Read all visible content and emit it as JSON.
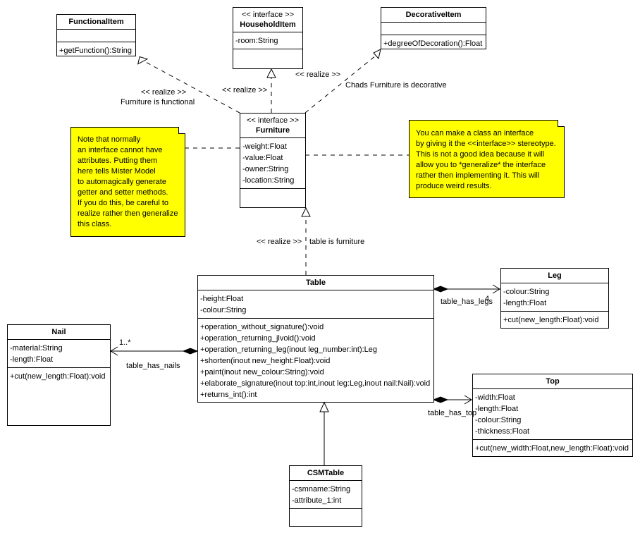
{
  "classes": {
    "functional_item": {
      "name": "FunctionalItem",
      "attributes": [],
      "operations": [
        "+getFunction():String"
      ]
    },
    "household_item": {
      "stereotype": "<< interface >>",
      "name": "HouseholdItem",
      "attributes": [
        "-room:String"
      ],
      "operations": []
    },
    "decorative_item": {
      "name": "DecorativeItem",
      "attributes": [],
      "operations": [
        "+degreeOfDecoration():Float"
      ]
    },
    "furniture": {
      "stereotype": "<< interface >>",
      "name": "Furniture",
      "attributes": [
        "-weight:Float",
        "-value:Float",
        "-owner:String",
        "-location:String"
      ],
      "operations": []
    },
    "table": {
      "name": "Table",
      "attributes": [
        "-height:Float",
        "-colour:String"
      ],
      "operations": [
        "+operation_without_signature():void",
        "+operation_returning_jlvoid():void",
        "+operation_returning_leg(inout leg_number:int):Leg",
        "+shorten(inout new_height:Float):void",
        "+paint(inout new_colour:String):void",
        "+elaborate_signature(inout top:int,inout leg:Leg,inout nail:Nail):void",
        "+returns_int():int"
      ]
    },
    "leg": {
      "name": "Leg",
      "attributes": [
        "-colour:String",
        "-length:Float"
      ],
      "operations": [
        "+cut(new_length:Float):void"
      ]
    },
    "nail": {
      "name": "Nail",
      "attributes": [
        "-material:String",
        "-length:Float"
      ],
      "operations": [
        "+cut(new_length:Float):void"
      ]
    },
    "top": {
      "name": "Top",
      "attributes": [
        "-width:Float",
        "-length:Float",
        "-colour:String",
        "-thickness:Float"
      ],
      "operations": [
        "+cut(new_width:Float,new_length:Float):void"
      ]
    },
    "csm_table": {
      "name": "CSMTable",
      "attributes": [
        "-csmname:String",
        "-attribute_1:int"
      ],
      "operations": []
    }
  },
  "notes": {
    "note_interface_attributes": [
      "Note that normally",
      "an interface cannot have",
      "attributes. Putting them",
      "here tells Mister Model",
      "to automagically generate",
      "getter and setter methods.",
      "If you do this, be careful to",
      "realize rather then generalize",
      "this class."
    ],
    "note_interface_stereotype": [
      "You can make a class an interface",
      "by giving it the <<interface>> stereotype.",
      "This is not a good idea because it will",
      "allow you to *generalize* the interface",
      "rather then implementing it. This will",
      "produce weird results."
    ]
  },
  "labels": {
    "realize_functional": "<< realize >>",
    "functional_name": "Furniture is functional",
    "realize_household": "<< realize >>",
    "realize_decorative": "<< realize >>",
    "decorative_name": "Chads Furniture is decorative",
    "realize_table": "<< realize >>",
    "table_name": "table is furniture",
    "legs_assoc": "table_has_legs",
    "legs_mult": "4",
    "nails_assoc": "table_has_nails",
    "nails_mult": "1..*",
    "top_assoc": "table_has_top"
  },
  "colors": {
    "note_fill": "#ffff00",
    "line": "#000000"
  }
}
